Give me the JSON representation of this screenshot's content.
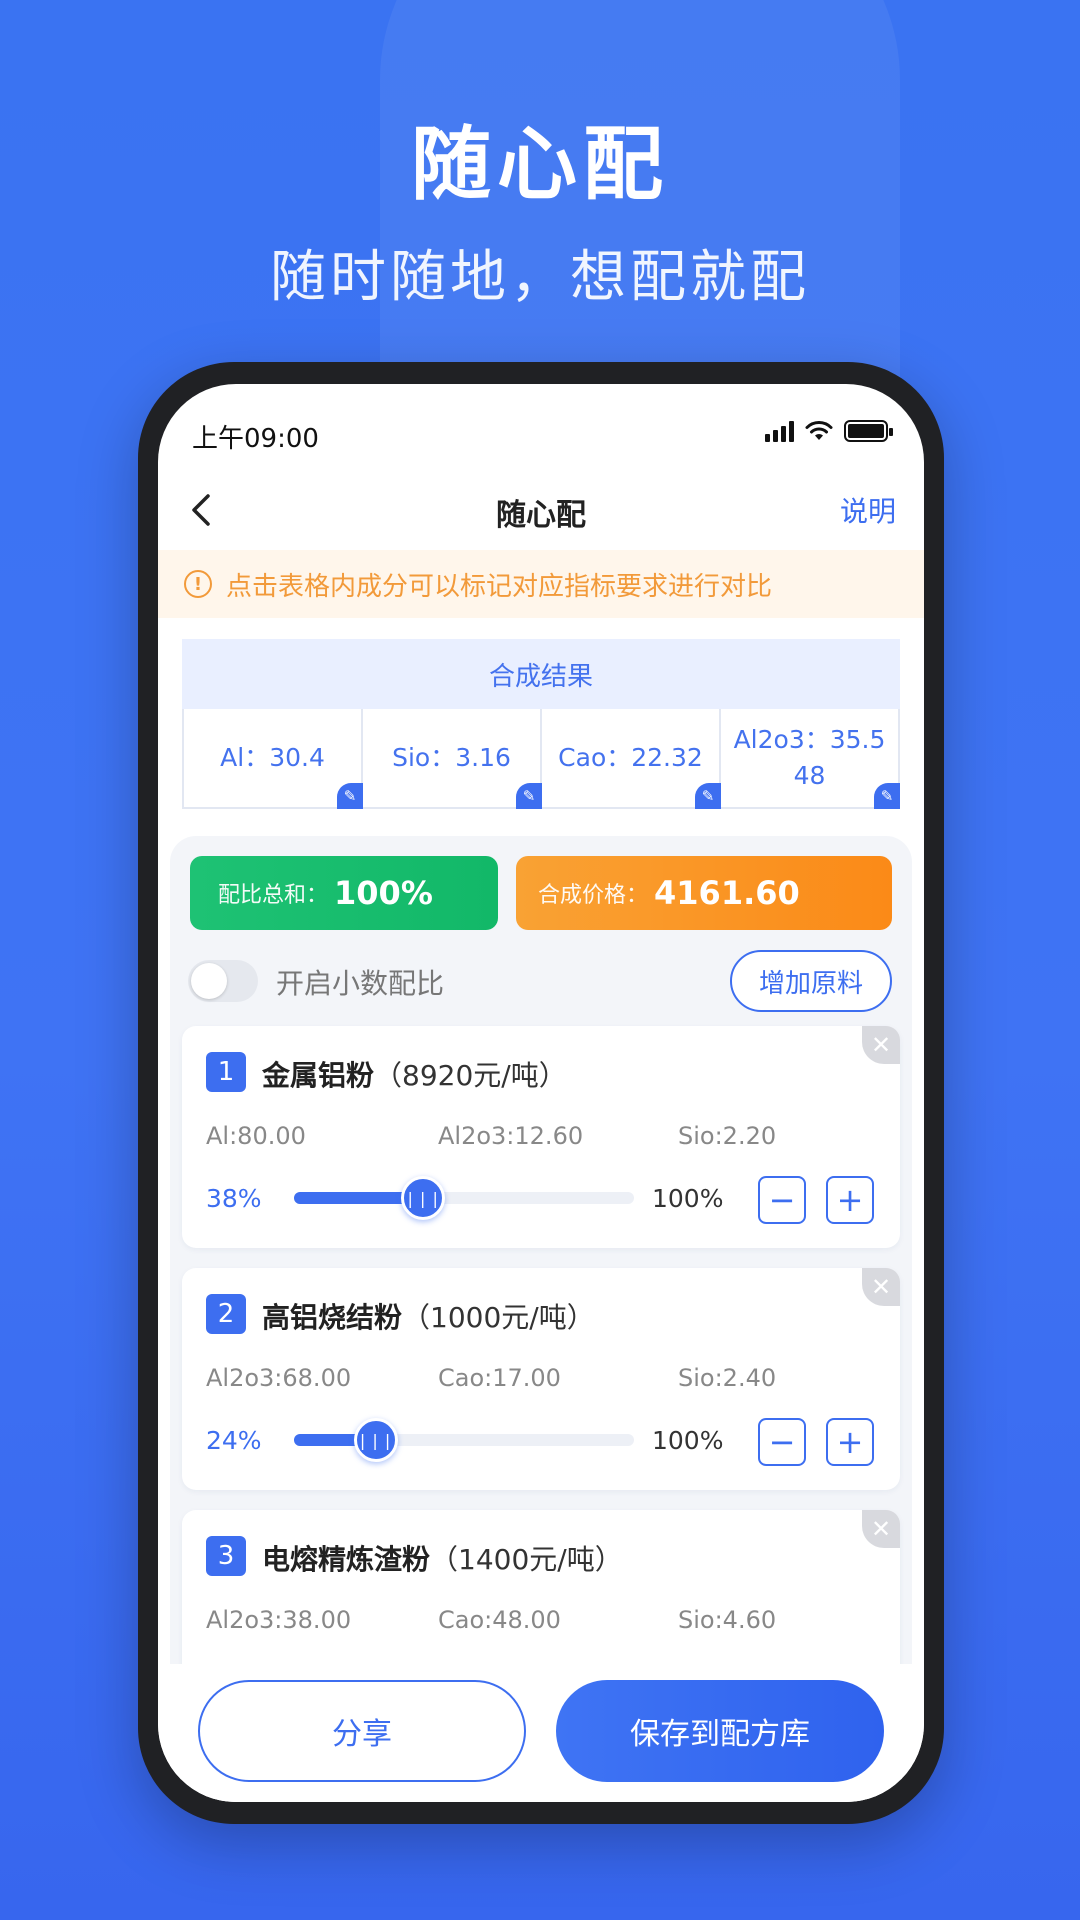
{
  "hero": {
    "title": "随心配",
    "subtitle": "随时随地，想配就配"
  },
  "status": {
    "time": "上午09:00"
  },
  "nav": {
    "title": "随心配",
    "help": "说明"
  },
  "notice": {
    "text": "点击表格内成分可以标记对应指标要求进行对比"
  },
  "result": {
    "title": "合成结果",
    "cells": [
      {
        "text": "Al：30.4"
      },
      {
        "text": "Sio：3.16"
      },
      {
        "text": "Cao：22.32"
      },
      {
        "text": "Al2o3：35.548"
      }
    ]
  },
  "summary": {
    "ratio_label": "配比总和：",
    "ratio_value": "100%",
    "price_label": "合成价格：",
    "price_value": "4161.60"
  },
  "options": {
    "decimal_toggle_label": "开启小数配比",
    "decimal_enabled": false,
    "add_material": "增加原料"
  },
  "materials": [
    {
      "index": "1",
      "name": "金属铝粉",
      "price": "（8920元/吨）",
      "components": [
        "Al:80.00",
        "Al2o3:12.60",
        "Sio:2.20"
      ],
      "percent_label": "38%",
      "percent": 38,
      "max_label": "100%",
      "minus": "−",
      "plus": "+"
    },
    {
      "index": "2",
      "name": "高铝烧结粉",
      "price": "（1000元/吨）",
      "components": [
        "Al2o3:68.00",
        "Cao:17.00",
        "Sio:2.40"
      ],
      "percent_label": "24%",
      "percent": 24,
      "max_label": "100%",
      "minus": "−",
      "plus": "+"
    },
    {
      "index": "3",
      "name": "电熔精炼渣粉",
      "price": "（1400元/吨）",
      "components": [
        "Al2o3:38.00",
        "Cao:48.00",
        "Sio:4.60"
      ]
    }
  ],
  "actions": {
    "share": "分享",
    "save": "保存到配方库"
  },
  "colors": {
    "primary": "#3d6ef0",
    "green": "#1ec274",
    "orange": "#fb8a17",
    "notice": "#f29a3a"
  }
}
